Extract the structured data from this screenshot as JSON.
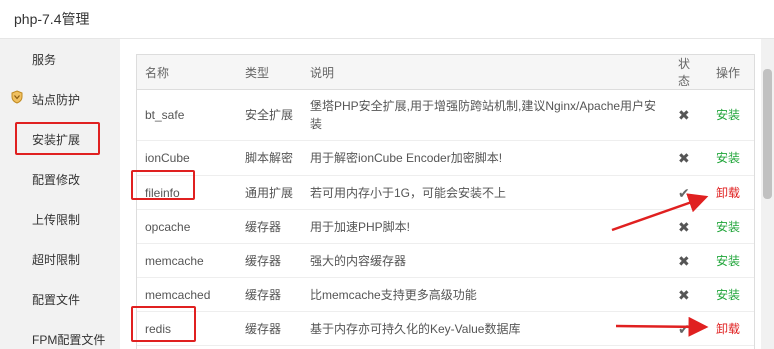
{
  "window": {
    "title": "php-7.4管理"
  },
  "sidebar": {
    "items": [
      {
        "label": "服务"
      },
      {
        "label": "站点防护"
      },
      {
        "label": "安装扩展"
      },
      {
        "label": "配置修改"
      },
      {
        "label": "上传限制"
      },
      {
        "label": "超时限制"
      },
      {
        "label": "配置文件"
      },
      {
        "label": "FPM配置文件"
      }
    ]
  },
  "table": {
    "headers": {
      "name": "名称",
      "type": "类型",
      "desc": "说明",
      "status": "状态",
      "action": "操作"
    },
    "rows": [
      {
        "name": "bt_safe",
        "type": "安全扩展",
        "desc": "堡塔PHP安全扩展,用于增强防跨站机制,建议Nginx/Apache用户安装",
        "status": "✖",
        "installed": false,
        "action": "安装"
      },
      {
        "name": "ionCube",
        "type": "脚本解密",
        "desc": "用于解密ionCube Encoder加密脚本!",
        "status": "✖",
        "installed": false,
        "action": "安装"
      },
      {
        "name": "fileinfo",
        "type": "通用扩展",
        "desc": "若可用内存小于1G，可能会安装不上",
        "status": "✔",
        "installed": true,
        "action": "卸载"
      },
      {
        "name": "opcache",
        "type": "缓存器",
        "desc": "用于加速PHP脚本!",
        "status": "✖",
        "installed": false,
        "action": "安装"
      },
      {
        "name": "memcache",
        "type": "缓存器",
        "desc": "强大的内容缓存器",
        "status": "✖",
        "installed": false,
        "action": "安装"
      },
      {
        "name": "memcached",
        "type": "缓存器",
        "desc": "比memcache支持更多高级功能",
        "status": "✖",
        "installed": false,
        "action": "安装"
      },
      {
        "name": "redis",
        "type": "缓存器",
        "desc": "基于内存亦可持久化的Key-Value数据库",
        "status": "✔",
        "installed": true,
        "action": "卸载"
      }
    ]
  },
  "colors": {
    "install": "#20a53a",
    "uninstall": "#e02020",
    "annotation": "#e02020"
  }
}
